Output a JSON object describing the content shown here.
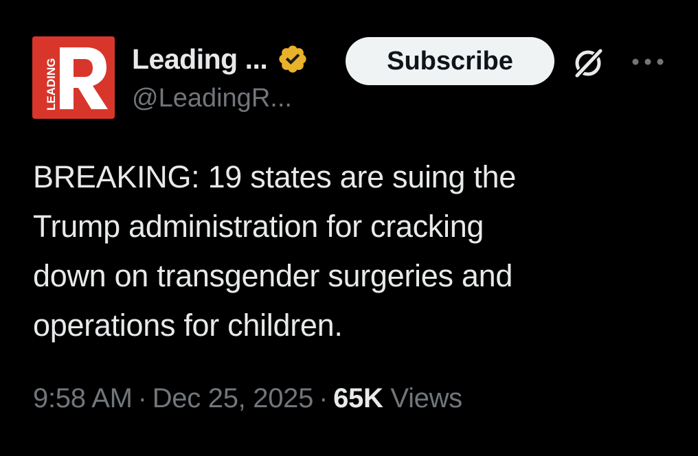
{
  "author": {
    "display_name": "Leading ...",
    "handle": "@LeadingR...",
    "avatar_letter": "R",
    "avatar_word": "LEADING",
    "avatar_color": "#d8362b",
    "verified": true,
    "verified_badge_color": "#e8b22a"
  },
  "actions": {
    "subscribe_label": "Subscribe",
    "grok_icon": "grok-icon",
    "more_icon": "more-icon"
  },
  "tweet": {
    "lines": [
      "BREAKING: 19 states are suing the",
      "Trump administration for cracking",
      "down on transgender surgeries and",
      "operations for children."
    ]
  },
  "meta": {
    "time": "9:58 AM",
    "date": "Dec 25, 2025",
    "separator": "·",
    "views_count": "65K",
    "views_label": "Views"
  }
}
